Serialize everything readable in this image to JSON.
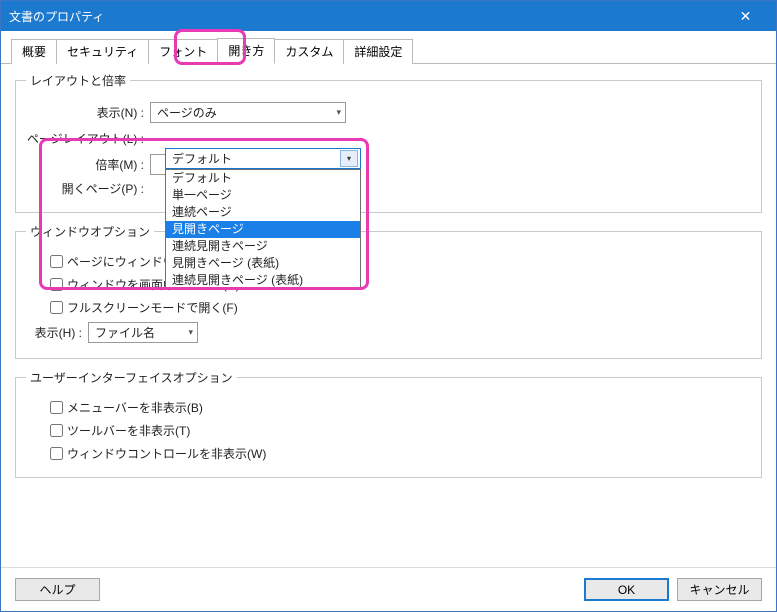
{
  "title": "文書のプロパティ",
  "tabs": [
    "概要",
    "セキュリティ",
    "フォント",
    "開き方",
    "カスタム",
    "詳細設定"
  ],
  "active_tab": 3,
  "group_layout": {
    "legend": "レイアウトと倍率",
    "display_label": "表示(N) :",
    "display_value": "ページのみ",
    "page_layout_label": "ページレイアウト(L) :",
    "page_layout_value": "デフォルト",
    "page_layout_options": [
      "デフォルト",
      "単一ページ",
      "連続ページ",
      "見開きページ",
      "連続見開きページ",
      "見開きページ (表紙)",
      "連続見開きページ (表紙)"
    ],
    "page_layout_selected_index": 3,
    "zoom_label": "倍率(M) :",
    "open_page_label": "開くページ(P) :"
  },
  "group_window": {
    "legend": "ウィンドウオプション",
    "chk_fit": "ページにウィンドウサイズを合わせる(R)",
    "chk_center": "ウィンドウを画面中央に配置(C)",
    "chk_fullscreen": "フルスクリーンモードで開く(F)",
    "show_label": "表示(H) :",
    "show_value": "ファイル名"
  },
  "group_ui": {
    "legend": "ユーザーインターフェイスオプション",
    "chk_menu": "メニューバーを非表示(B)",
    "chk_toolbar": "ツールバーを非表示(T)",
    "chk_winctrl": "ウィンドウコントロールを非表示(W)"
  },
  "buttons": {
    "help": "ヘルプ",
    "ok": "OK",
    "cancel": "キャンセル"
  }
}
